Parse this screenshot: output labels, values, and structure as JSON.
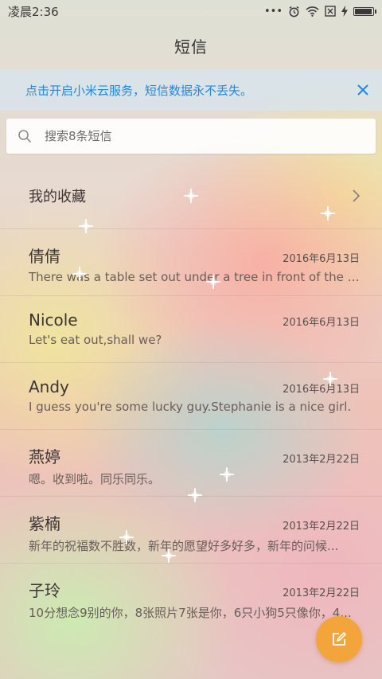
{
  "status_bar": {
    "time": "凌晨2:36",
    "icons": [
      "more-dots-icon",
      "alarm-icon",
      "wifi-icon",
      "sim-off-icon",
      "charging-icon",
      "battery-icon"
    ],
    "battery_level": 0.95
  },
  "header": {
    "title": "短信"
  },
  "banner": {
    "text": "点击开启小米云服务，短信数据永不丢失。",
    "close_icon": "close-icon"
  },
  "search": {
    "placeholder": "搜索8条短信",
    "value": ""
  },
  "favorites": {
    "label": "我的收藏"
  },
  "conversations": [
    {
      "name": "倩倩",
      "date": "2016年6月13日",
      "preview": "There was a table set out under a tree in front of the ho..."
    },
    {
      "name": "Nicole",
      "date": "2016年6月13日",
      "preview": "Let's eat out,shall we?"
    },
    {
      "name": "Andy",
      "date": "2016年6月13日",
      "preview": "I guess you're some lucky guy.Stephanie is a nice girl."
    },
    {
      "name": "燕婷",
      "date": "2013年2月22日",
      "preview": "嗯。收到啦。同乐同乐。"
    },
    {
      "name": "紫楠",
      "date": "2013年2月22日",
      "preview": "新年的祝福数不胜数，新年的愿望好多好多，新年的问候..."
    },
    {
      "name": "子玲",
      "date": "2013年2月22日",
      "preview": "10分想念9别的你，8张照片7张是你，6只小狗5只像你，4..."
    }
  ],
  "fab": {
    "icon": "compose-icon",
    "color": "#f3a43a"
  },
  "colors": {
    "accent": "#1e88e5",
    "fab": "#f3a43a"
  }
}
